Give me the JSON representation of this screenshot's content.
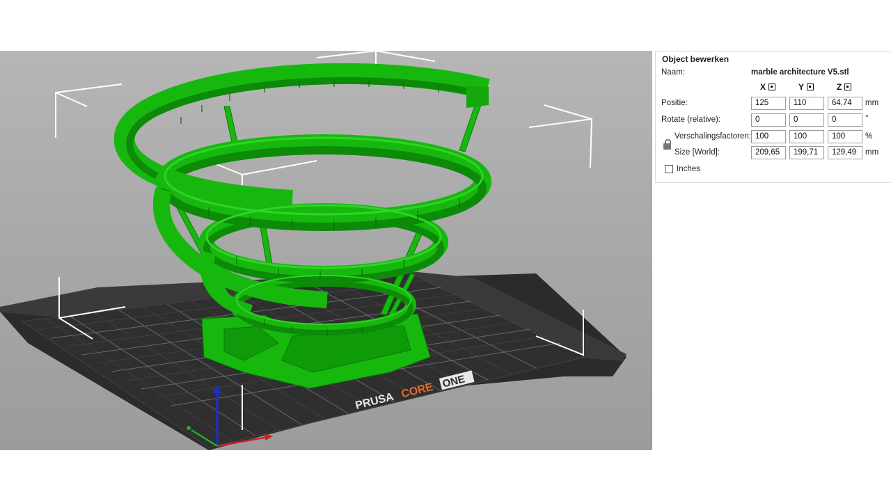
{
  "viewport": {
    "bed_brand": "PRUSA",
    "bed_model": "CORE",
    "bed_model_badge": "ONE",
    "colors": {
      "model": "#16b80e",
      "bed": "#2a2a2a",
      "brand_orange": "#e8692c",
      "grid": "#5a5a5a"
    }
  },
  "panel": {
    "title": "Object bewerken",
    "name_label": "Naam:",
    "name_value": "marble architecture V5.stl",
    "axes": {
      "x": "X",
      "y": "Y",
      "z": "Z"
    },
    "position": {
      "label": "Positie:",
      "x": "125",
      "y": "110",
      "z": "64,74",
      "unit": "mm"
    },
    "rotate": {
      "label": "Rotate (relative):",
      "x": "0",
      "y": "0",
      "z": "0",
      "unit": "°"
    },
    "scale": {
      "label": "Verschalingsfactoren:",
      "x": "100",
      "y": "100",
      "z": "100",
      "unit": "%"
    },
    "size": {
      "label": "Size [World]:",
      "x": "209,65",
      "y": "199,71",
      "z": "129,49",
      "unit": "mm"
    },
    "inches_label": "Inches",
    "inches_checked": false
  }
}
